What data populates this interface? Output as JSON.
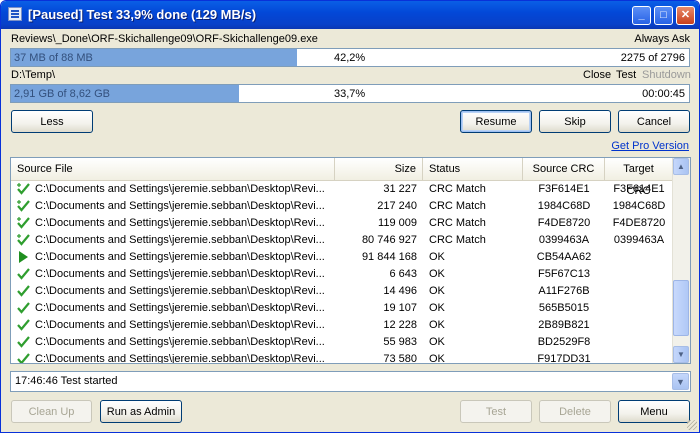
{
  "window": {
    "title": "[Paused] Test 33,9% done (129 MB/s)"
  },
  "file": {
    "path": "Reviews\\_Done\\ORF-Skichallenge09\\ORF-Skichallenge09.exe",
    "mode": "Always Ask",
    "size_text": "37 MB of 88 MB",
    "percent": "42,2%",
    "progress_fraction": 0.422,
    "count": "2275 of 2796"
  },
  "total": {
    "target": "D:\\Temp\\",
    "actions": {
      "close": "Close",
      "test": "Test",
      "shutdown": "Shutdown"
    },
    "size_text": "2,91 GB of 8,62 GB",
    "percent": "33,7%",
    "progress_fraction": 0.337,
    "time": "00:00:45"
  },
  "buttons": {
    "less": "Less",
    "resume": "Resume",
    "skip": "Skip",
    "cancel": "Cancel",
    "get_pro": "Get Pro Version",
    "clean_up": "Clean Up",
    "run_as_admin": "Run as Admin",
    "test": "Test",
    "delete": "Delete",
    "menu": "Menu"
  },
  "table": {
    "columns": [
      "Source File",
      "Size",
      "Status",
      "Source CRC",
      "Target CRC"
    ],
    "rows": [
      {
        "icon": "check-plus-icon",
        "file": "C:\\Documents and Settings\\jeremie.sebban\\Desktop\\Revi...",
        "size": "31 227",
        "status": "CRC Match",
        "src_crc": "F3F614E1",
        "tgt_crc": "F3F614E1"
      },
      {
        "icon": "check-plus-icon",
        "file": "C:\\Documents and Settings\\jeremie.sebban\\Desktop\\Revi...",
        "size": "217 240",
        "status": "CRC Match",
        "src_crc": "1984C68D",
        "tgt_crc": "1984C68D"
      },
      {
        "icon": "check-plus-icon",
        "file": "C:\\Documents and Settings\\jeremie.sebban\\Desktop\\Revi...",
        "size": "119 009",
        "status": "CRC Match",
        "src_crc": "F4DE8720",
        "tgt_crc": "F4DE8720"
      },
      {
        "icon": "check-plus-icon",
        "file": "C:\\Documents and Settings\\jeremie.sebban\\Desktop\\Revi...",
        "size": "80 746 927",
        "status": "CRC Match",
        "src_crc": "0399463A",
        "tgt_crc": "0399463A"
      },
      {
        "icon": "play-icon",
        "file": "C:\\Documents and Settings\\jeremie.sebban\\Desktop\\Revi...",
        "size": "91 844 168",
        "status": "OK",
        "src_crc": "CB54AA62",
        "tgt_crc": ""
      },
      {
        "icon": "check-icon",
        "file": "C:\\Documents and Settings\\jeremie.sebban\\Desktop\\Revi...",
        "size": "6 643",
        "status": "OK",
        "src_crc": "F5F67C13",
        "tgt_crc": ""
      },
      {
        "icon": "check-icon",
        "file": "C:\\Documents and Settings\\jeremie.sebban\\Desktop\\Revi...",
        "size": "14 496",
        "status": "OK",
        "src_crc": "A11F276B",
        "tgt_crc": ""
      },
      {
        "icon": "check-icon",
        "file": "C:\\Documents and Settings\\jeremie.sebban\\Desktop\\Revi...",
        "size": "19 107",
        "status": "OK",
        "src_crc": "565B5015",
        "tgt_crc": ""
      },
      {
        "icon": "check-icon",
        "file": "C:\\Documents and Settings\\jeremie.sebban\\Desktop\\Revi...",
        "size": "12 228",
        "status": "OK",
        "src_crc": "2B89B821",
        "tgt_crc": ""
      },
      {
        "icon": "check-icon",
        "file": "C:\\Documents and Settings\\jeremie.sebban\\Desktop\\Revi...",
        "size": "55 983",
        "status": "OK",
        "src_crc": "BD2529F8",
        "tgt_crc": ""
      },
      {
        "icon": "check-icon",
        "file": "C:\\Documents and Settings\\jeremie.sebban\\Desktop\\Revi...",
        "size": "73 580",
        "status": "OK",
        "src_crc": "F917DD31",
        "tgt_crc": ""
      }
    ]
  },
  "log": {
    "selected": "17:46:46 Test started"
  },
  "colors": {
    "titlebar": "#0348d8",
    "progress": "#78a4dc",
    "check": "#2f9e2f",
    "link": "#0033cc"
  }
}
